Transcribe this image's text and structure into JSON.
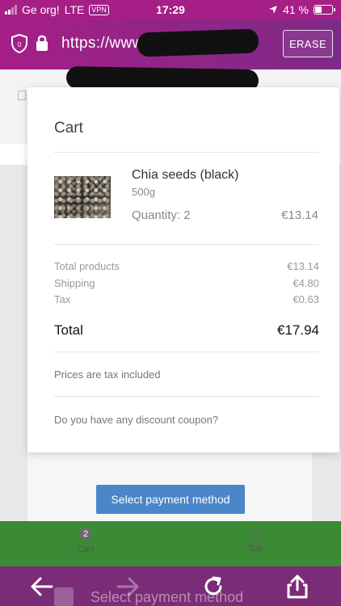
{
  "status_bar": {
    "carrier": "Ge org!",
    "network": "LTE",
    "vpn": "VPN",
    "time": "17:29",
    "battery": "41 %",
    "battery_level": 0.41
  },
  "browser": {
    "url": "https://www",
    "erase_label": "ERASE"
  },
  "cart": {
    "title": "Cart",
    "product": {
      "name": "Chia seeds (black)",
      "variant": "500g",
      "quantity": "Quantity: 2",
      "price": "€13.14"
    },
    "summary": [
      {
        "label": "Total products",
        "value": "€13.14"
      },
      {
        "label": "Shipping",
        "value": "€4.80"
      },
      {
        "label": "Tax",
        "value": "€0.63"
      }
    ],
    "total": {
      "label": "Total",
      "value": "€17.94"
    },
    "tax_note": "Prices are tax included",
    "coupon_prompt": "Do you have any discount coupon?"
  },
  "payment_button": "Select payment method",
  "bottom_nav": {
    "cart_count": "2",
    "cart_label": "Cart",
    "top_label": "Top"
  },
  "background_text": "Select payment method",
  "colors": {
    "brand": "#a51f87",
    "toolbar": "#7b2c77",
    "green_bar": "#3a8a36",
    "primary_button": "#4a86c8"
  }
}
